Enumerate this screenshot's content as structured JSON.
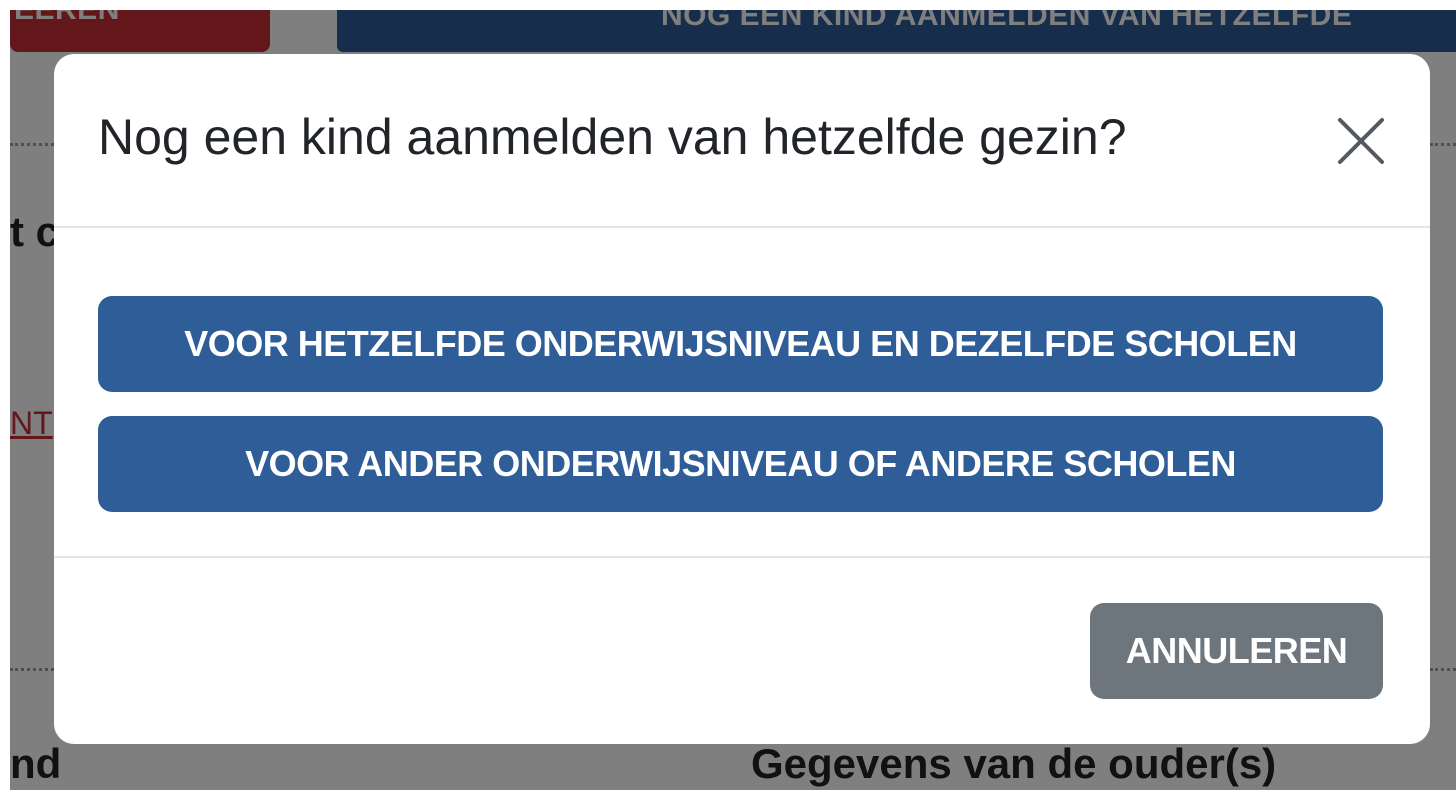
{
  "background": {
    "red_button_label": "EEREN",
    "blue_button_label": "NOG EEN KIND AANMELDEN VAN HETZELFDE",
    "left_heading_fragment": "t c",
    "left_link_fragment": "NT",
    "bottom_left_heading_fragment": "nd",
    "parents_heading": "Gegevens van de ouder(s)"
  },
  "modal": {
    "title": "Nog een kind aanmelden van hetzelfde gezin?",
    "close_icon": "close-icon",
    "options": [
      {
        "label": "VOOR HETZELFDE ONDERWIJSNIVEAU EN DEZELFDE SCHOLEN"
      },
      {
        "label": "VOOR ANDER ONDERWIJSNIVEAU OF ANDERE SCHOLEN"
      }
    ],
    "cancel_label": "ANNULEREN"
  },
  "colors": {
    "primary": "#2e5d97",
    "secondary": "#6d757d",
    "danger": "#c62f36",
    "overlay": "rgba(0,0,0,0.5)"
  }
}
